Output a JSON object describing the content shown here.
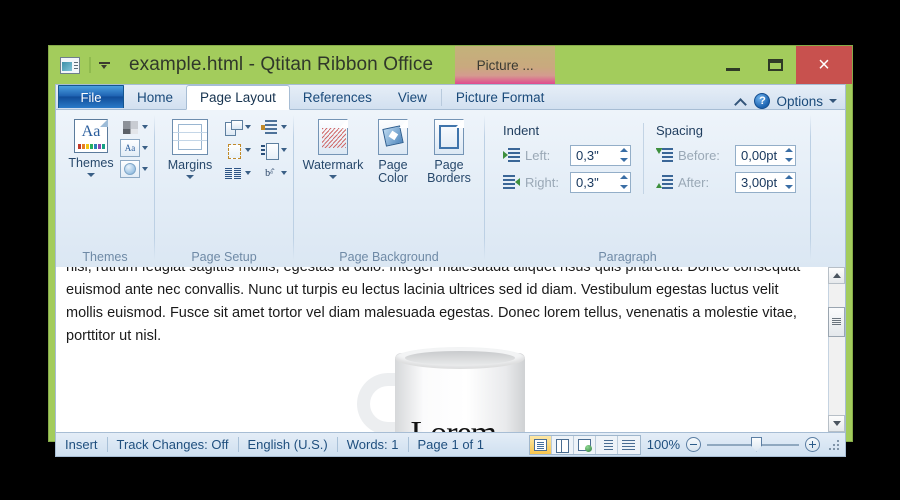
{
  "window": {
    "title": "example.html - Qtitan Ribbon Office",
    "app_icon": "app-window-icon",
    "qat_dropdown_icon": "chevron-down-icon",
    "minimize_label": "minimize-icon",
    "maximize_label": "maximize-icon",
    "close_label": "×",
    "frame_color": "#a3cc5c",
    "contextual_tab_label": "Picture ..."
  },
  "ribbon": {
    "file_tab": "File",
    "tabs": [
      {
        "label": "Home",
        "active": false
      },
      {
        "label": "Page Layout",
        "active": true
      },
      {
        "label": "References",
        "active": false
      },
      {
        "label": "View",
        "active": false
      },
      {
        "label": "Picture Format",
        "active": false
      }
    ],
    "right": {
      "collapse_icon": "chevron-up-icon",
      "help_icon": "?",
      "options_label": "Options",
      "options_caret": "caret-down-icon"
    },
    "groups": [
      {
        "name": "Themes",
        "label": "Themes",
        "big_button": {
          "label": "Themes",
          "icon": "themes-aa-icon"
        },
        "small_buttons": [
          {
            "name": "theme-colors",
            "icon": "color-block-icon"
          },
          {
            "name": "theme-fonts",
            "icon": "font-aa-icon"
          },
          {
            "name": "theme-effects",
            "icon": "effects-circle-icon"
          }
        ]
      },
      {
        "name": "Page Setup",
        "label": "Page Setup",
        "big_button": {
          "label": "Margins",
          "icon": "margins-icon"
        },
        "small_buttons": [
          {
            "name": "orientation",
            "icon": "orientation-icon"
          },
          {
            "name": "breaks",
            "icon": "breaks-icon"
          },
          {
            "name": "size",
            "icon": "page-size-icon"
          },
          {
            "name": "line-numbers",
            "icon": "line-numbers-icon"
          },
          {
            "name": "columns",
            "icon": "columns-icon"
          },
          {
            "name": "hyphenation",
            "icon": "hyphenation-icon"
          }
        ]
      },
      {
        "name": "Page Background",
        "label": "Page Background",
        "buttons": [
          {
            "label": "Watermark",
            "icon": "watermark-icon",
            "has_caret": true
          },
          {
            "label": "Page Color",
            "icon": "page-color-icon",
            "has_caret": true
          },
          {
            "label": "Page Borders",
            "icon": "page-borders-icon",
            "has_caret": false
          }
        ]
      },
      {
        "name": "Paragraph",
        "label": "Paragraph",
        "indent": {
          "heading": "Indent",
          "left_label": "Left:",
          "left_value": "0,3\"",
          "right_label": "Right:",
          "right_value": "0,3\""
        },
        "spacing": {
          "heading": "Spacing",
          "before_label": "Before:",
          "before_value": "0,00pt",
          "after_label": "After:",
          "after_value": "3,00pt"
        }
      }
    ]
  },
  "document": {
    "paragraph": "nisl, rutrum feugiat sagittis mollis, egestas id odio. Integer malesuada aliquet risus quis pharetra. Donec consequat euismod ante nec convallis. Nunc ut turpis eu lectus lacinia ultrices sed id diam. Vestibulum egestas luctus velit mollis euismod. Fusce sit amet tortor vel diam malesuada egestas. Donec lorem tellus, venenatis a molestie vitae, porttitor ut nisl.",
    "image_caption": "Lorem",
    "image_alt": "coffee-mug-image",
    "scrollbar": {
      "up_icon": "scroll-up-arrow",
      "down_icon": "scroll-down-arrow",
      "thumb": "scroll-thumb"
    }
  },
  "statusbar": {
    "items": [
      "Insert",
      "Track Changes: Off",
      "English (U.S.)",
      "Words: 1",
      "Page 1 of 1"
    ],
    "view_buttons": [
      {
        "name": "print-layout",
        "selected": true
      },
      {
        "name": "full-screen-reading",
        "selected": false
      },
      {
        "name": "web-layout",
        "selected": false
      },
      {
        "name": "outline",
        "selected": false
      },
      {
        "name": "draft",
        "selected": false
      }
    ],
    "zoom_level": "100%",
    "zoom_out_icon": "zoom-out-icon",
    "zoom_in_icon": "zoom-in-icon",
    "resize_grip": "resize-grip-icon"
  }
}
